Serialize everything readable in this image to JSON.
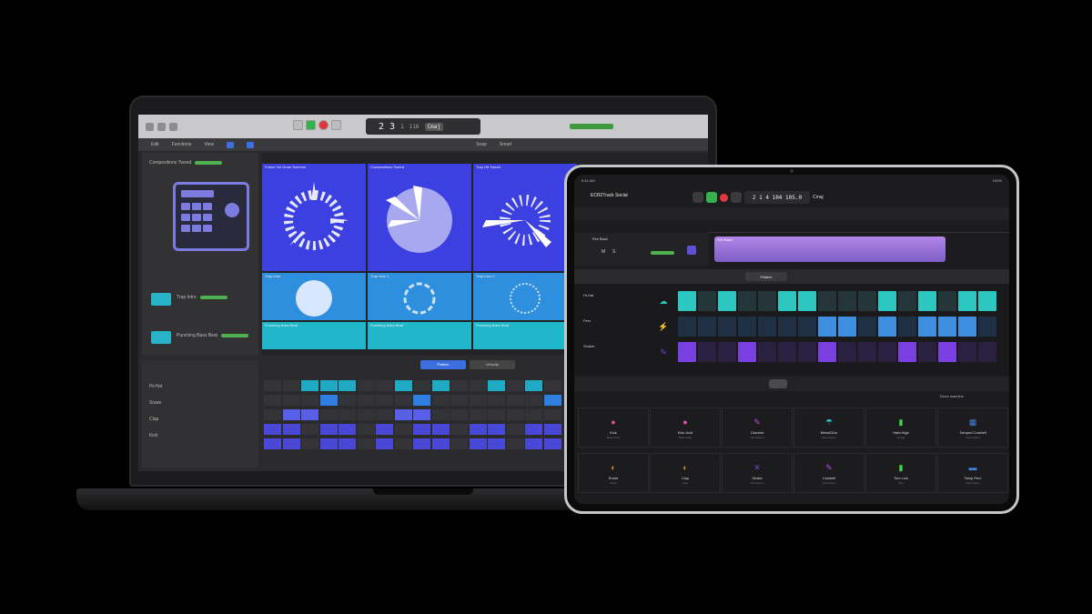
{
  "mac": {
    "lcd_bar": "2",
    "lcd_beat": "3",
    "lcd_div": "1",
    "lcd_tempo": "116",
    "lcd_key": "Cmaj",
    "toolbar": [
      "Edit",
      "Functions",
      "View",
      "Snap",
      "Smart"
    ],
    "inspector": {
      "track1": "Compositions Tweed",
      "track2": "Trap Intro",
      "track3": "Punching Bass Beat"
    },
    "tiles": [
      {
        "label": "Future Vol Drum Summer",
        "color": "#3d40e0"
      },
      {
        "label": "Compositions Tweed",
        "color": "#3d40e0"
      },
      {
        "label": "Trap Hit Tweed",
        "color": "#3d40e0"
      },
      {
        "label": "Trap Intro",
        "color": "#2d8fdd"
      },
      {
        "label": "Trap Intro 1",
        "color": "#2d8fdd"
      },
      {
        "label": "Trap Intro 2",
        "color": "#2d8fdd"
      },
      {
        "label": "Punching Bass Beat",
        "color": "#1fb7c9"
      },
      {
        "label": "Punching Bass Beat",
        "color": "#1fb7c9"
      },
      {
        "label": "Punching Bass Beat",
        "color": "#1fb7c9"
      }
    ],
    "editor": {
      "rows": [
        "Hi-Hat",
        "Snare",
        "Clap",
        "Kick"
      ],
      "tab": "Pattern",
      "tab2": "Velocity"
    }
  },
  "ipad": {
    "status_left": "9:41 AM",
    "status_right": "100%",
    "project_title": "ECR2Track Social",
    "lcd": "2 1 4 104  105.0",
    "lcd_key": "Cmaj",
    "track_name": "Fire Bowl",
    "region_label": "Fire Bowl",
    "seq_tab": "Pattern",
    "rows": [
      {
        "name": "Hi-Hat",
        "color": "#2bc7c0",
        "icon": "☁",
        "steps": [
          1,
          0,
          1,
          0,
          0,
          1,
          1,
          0,
          0,
          0,
          1,
          0,
          1,
          0,
          1,
          1
        ]
      },
      {
        "name": "Perc",
        "color": "#3f8fe0",
        "icon": "⚡",
        "steps": [
          0,
          0,
          0,
          0,
          0,
          0,
          0,
          1,
          1,
          0,
          1,
          0,
          1,
          1,
          1,
          0
        ]
      },
      {
        "name": "Shaker",
        "color": "#7a3fe0",
        "icon": "✎",
        "steps": [
          1,
          0,
          0,
          1,
          0,
          0,
          0,
          1,
          0,
          0,
          0,
          1,
          0,
          1,
          0,
          0
        ]
      }
    ],
    "preset_label": "Drum machine",
    "library": [
      {
        "name": "Kick",
        "sub": "Bass drum",
        "icon": "●",
        "color": "#e0508f"
      },
      {
        "name": "Kick Acid",
        "sub": "Bass drum",
        "icon": "●",
        "color": "#e64fbf"
      },
      {
        "name": "Clavinet",
        "sub": "Percussion",
        "icon": "✎",
        "color": "#b44fe0"
      },
      {
        "name": "MetalClick",
        "sub": "Percussion",
        "icon": "☂",
        "color": "#2bc7c0"
      },
      {
        "name": "Hats High",
        "sub": "Hi-hat",
        "icon": "▮",
        "color": "#3dd64f"
      },
      {
        "name": "Tomped Cowbell",
        "sub": "Percussion",
        "icon": "▦",
        "color": "#3f7fe0"
      },
      {
        "name": "Snare",
        "sub": "Snare",
        "icon": "◐",
        "color": "#e08a2b"
      },
      {
        "name": "Clap",
        "sub": "Clap",
        "icon": "◐",
        "color": "#e08a2b"
      },
      {
        "name": "Shake",
        "sub": "Percussion",
        "icon": "✕",
        "color": "#7a3fe0"
      },
      {
        "name": "Cowbell",
        "sub": "Percussion",
        "icon": "✎",
        "color": "#b44fe0"
      },
      {
        "name": "Tom Low",
        "sub": "Tom",
        "icon": "▮",
        "color": "#3dd64f"
      },
      {
        "name": "Tamp Perc",
        "sub": "Percussion",
        "icon": "▬",
        "color": "#3f7fe0"
      }
    ]
  }
}
